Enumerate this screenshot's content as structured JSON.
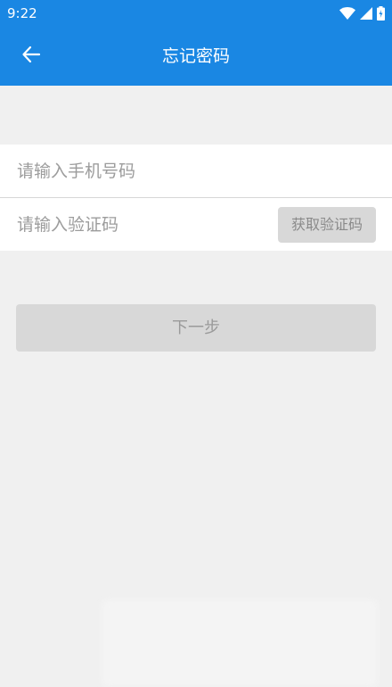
{
  "status_bar": {
    "time": "9:22",
    "icons": [
      "wifi-icon",
      "signal-icon",
      "battery-charging-icon"
    ]
  },
  "app_bar": {
    "title": "忘记密码",
    "back_icon": "arrow-left-icon"
  },
  "form": {
    "phone_placeholder": "请输入手机号码",
    "phone_value": "",
    "code_placeholder": "请输入验证码",
    "code_value": "",
    "get_code_label": "获取验证码"
  },
  "next_label": "下一步",
  "colors": {
    "primary": "#1a87e3",
    "background": "#f0f0f0",
    "button_disabled": "#d8d8d8"
  }
}
